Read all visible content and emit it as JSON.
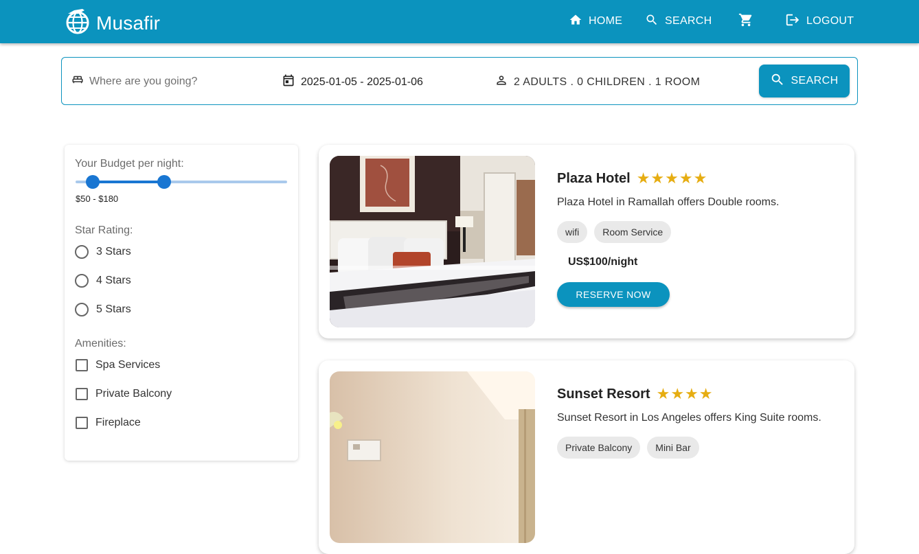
{
  "brand": {
    "title": "Musafir"
  },
  "nav": {
    "home": "HOME",
    "search": "SEARCH",
    "logout": "LOGOUT"
  },
  "search": {
    "destination_placeholder": "Where are you going?",
    "destination_value": "",
    "dates": "2025-01-05 - 2025-01-06",
    "guests": "2 ADULTS . 0 CHILDREN . 1 ROOM",
    "button": "SEARCH"
  },
  "filters": {
    "budget_label": "Your Budget per night:",
    "budget_range_text": "$50 - $180",
    "budget_low_fraction": 0.08,
    "budget_high_fraction": 0.42,
    "star_label": "Star Rating:",
    "star_options": [
      "3 Stars",
      "4 Stars",
      "5 Stars"
    ],
    "amenities_label": "Amenities:",
    "amenity_options": [
      "Spa Services",
      "Private Balcony",
      "Fireplace"
    ]
  },
  "hotels": [
    {
      "name": "Plaza Hotel",
      "stars": "★★★★★",
      "description": "Plaza Hotel in Ramallah offers Double rooms.",
      "amenities": [
        "wifi",
        "Room Service"
      ],
      "price": "US$100/night",
      "button": "RESERVE NOW"
    },
    {
      "name": "Sunset Resort",
      "stars": "★★★★",
      "description": "Sunset Resort in Los Angeles offers King Suite rooms.",
      "amenities": [
        "Private Balcony",
        "Mini Bar"
      ]
    }
  ],
  "colors": {
    "primary": "#0b93be",
    "slider": "#1976d2",
    "star": "#e6ad12"
  }
}
